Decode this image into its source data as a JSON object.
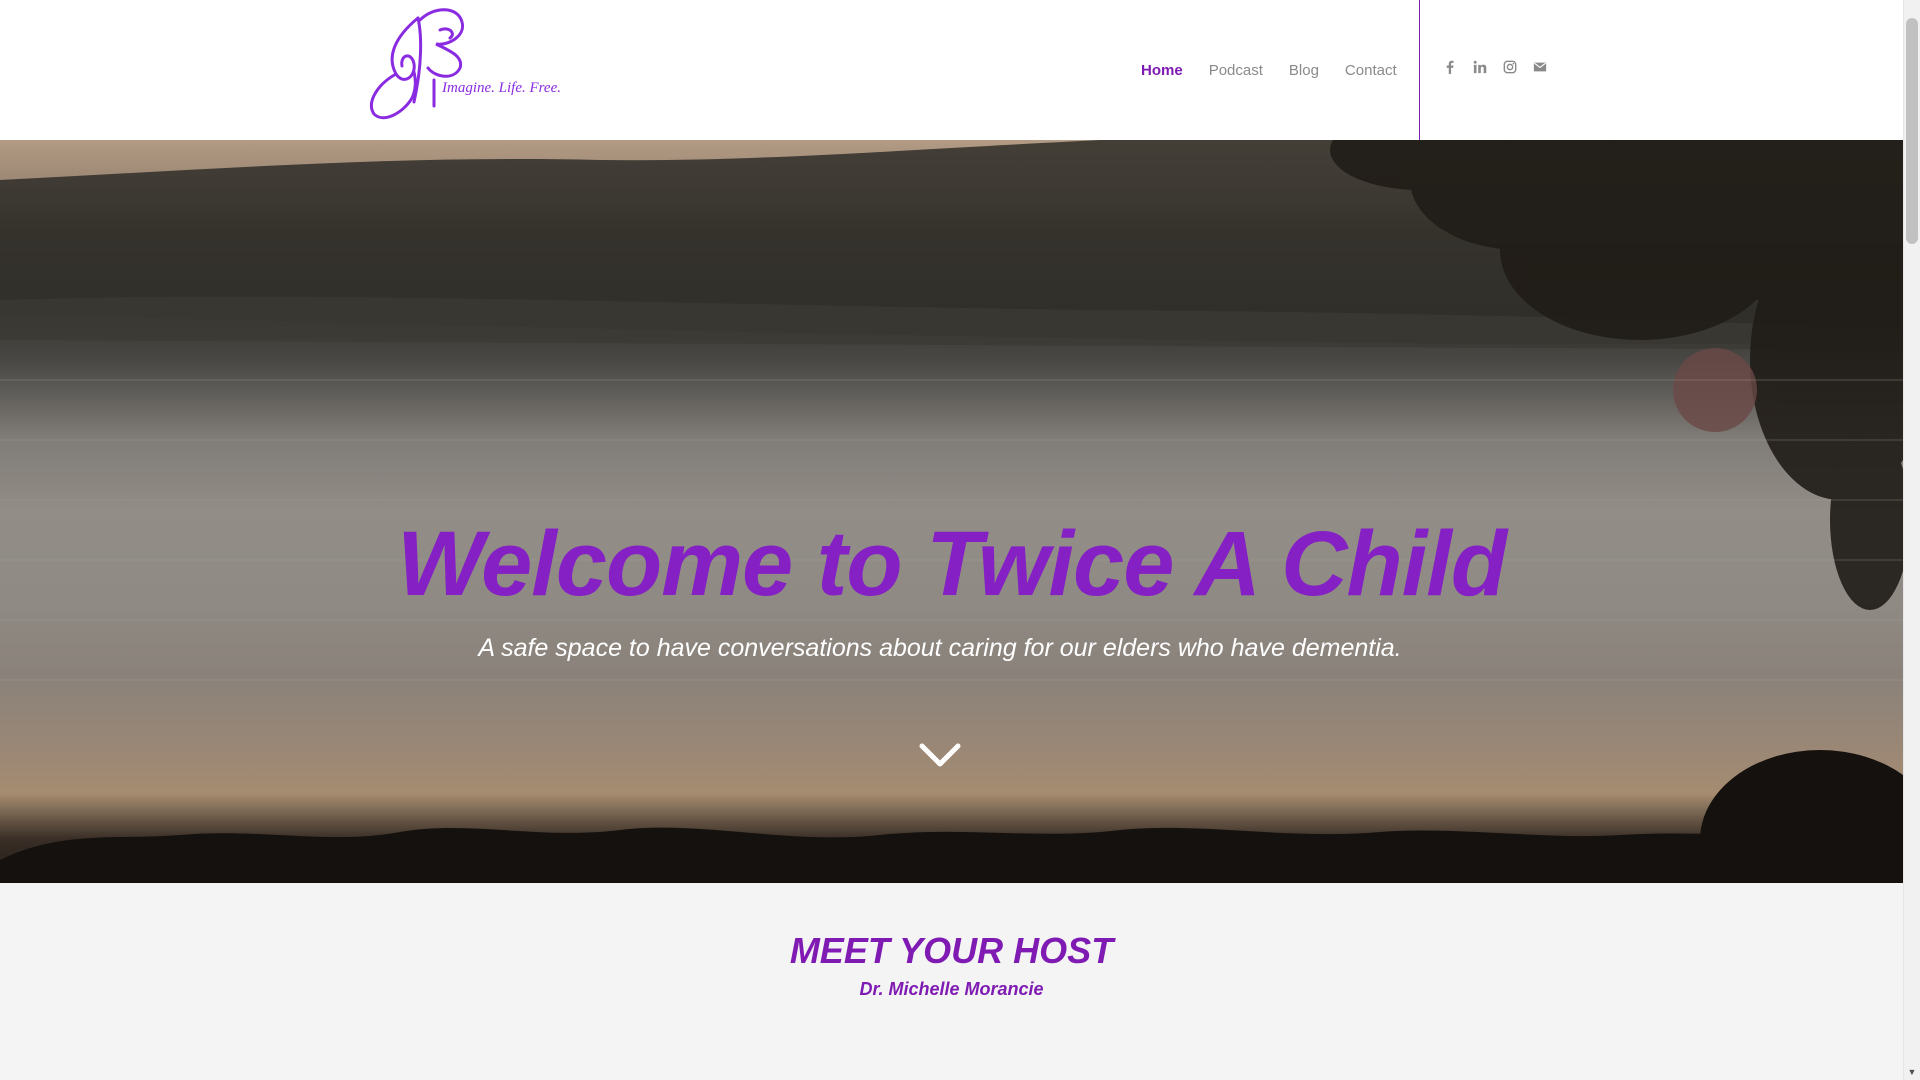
{
  "header": {
    "logo_tagline": "Imagine. Life. Free.",
    "nav": [
      {
        "label": "Home",
        "active": true
      },
      {
        "label": "Podcast",
        "active": false
      },
      {
        "label": "Blog",
        "active": false
      },
      {
        "label": "Contact",
        "active": false
      }
    ],
    "social_icons": [
      "facebook-icon",
      "linkedin-icon",
      "instagram-icon",
      "mail-icon"
    ]
  },
  "hero": {
    "title": "Welcome to Twice A Child",
    "subtitle": "A safe space to have conversations about caring for our elders who have dementia.",
    "scroll_icon": "chevron-down-icon"
  },
  "host": {
    "heading": "MEET YOUR HOST",
    "name": "Dr. Michelle Morancie"
  },
  "colors": {
    "brand_purple": "#7f1bb3",
    "nav_gray": "#8a8a8a",
    "section_bg": "#f4f4f4"
  }
}
